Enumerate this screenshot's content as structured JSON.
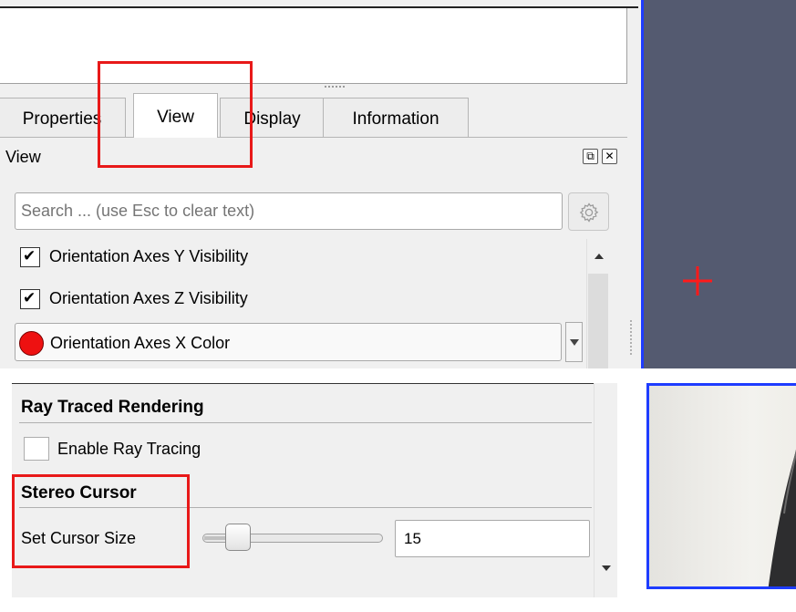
{
  "tabs": [
    {
      "label": "Properties"
    },
    {
      "label": "View"
    },
    {
      "label": "Display"
    },
    {
      "label": "Information"
    }
  ],
  "active_tab": "View",
  "view_section": {
    "title": "View",
    "dock_float_icon": "float-icon",
    "dock_close_icon": "close-icon"
  },
  "search": {
    "placeholder": "Search ... (use Esc to clear text)",
    "settings_icon": "gear-icon"
  },
  "properties": {
    "orientation_y": {
      "label": "Orientation Axes Y Visibility",
      "checked": true
    },
    "orientation_z": {
      "label": "Orientation Axes Z Visibility",
      "checked": true
    },
    "orientation_x_color": {
      "label": "Orientation Axes X Color",
      "color": "#ee1111"
    }
  },
  "ray_traced": {
    "title": "Ray Traced Rendering",
    "enable_label": "Enable Ray Tracing",
    "enabled": false
  },
  "stereo_cursor": {
    "title": "Stereo Cursor",
    "size_label": "Set Cursor Size",
    "size_value": "15"
  },
  "colors": {
    "viewport_background": "#545a70",
    "viewport_border": "#1e3cff",
    "highlight": "#e81919",
    "cursor_cross": "#ff1a1a"
  }
}
